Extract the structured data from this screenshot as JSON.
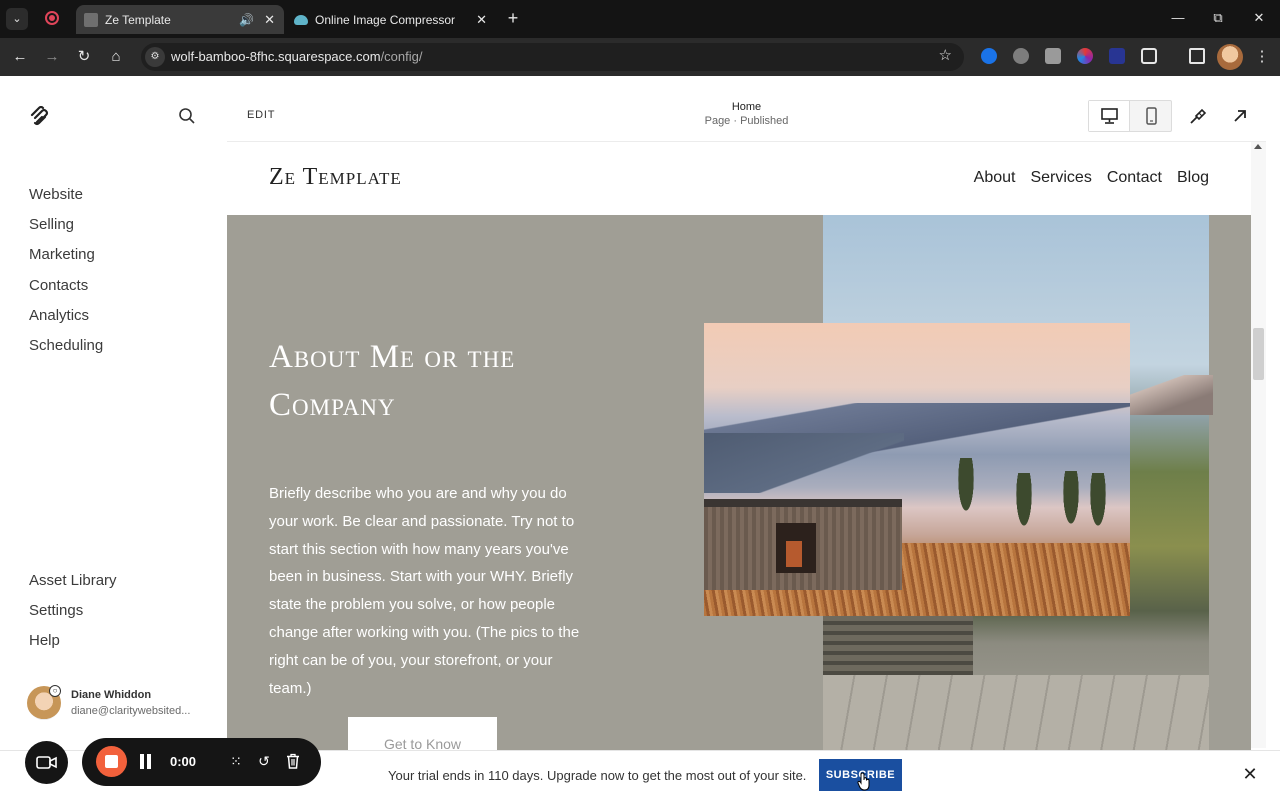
{
  "browser": {
    "tabs": [
      {
        "title": "Ze Template",
        "active": true,
        "audio": true
      },
      {
        "title": "Online Image Compressor",
        "active": false
      }
    ],
    "url_host": "wolf-bamboo-8fhc.squarespace.com",
    "url_path": "/config/",
    "icons": {
      "back": "←",
      "forward": "→",
      "reload": "↻",
      "home": "⌂",
      "star": "☆",
      "newtab": "+",
      "minimize": "—",
      "restore": "⧉",
      "close": "✕",
      "tab_close": "✕",
      "audio": "🔊",
      "tab_search": "⌄"
    }
  },
  "sidebar": {
    "nav": [
      "Website",
      "Selling",
      "Marketing",
      "Contacts",
      "Analytics",
      "Scheduling"
    ],
    "bottom": [
      "Asset Library",
      "Settings",
      "Help"
    ],
    "user": {
      "name": "Diane Whiddon",
      "email": "diane@claritywebsited..."
    }
  },
  "editor": {
    "edit_label": "EDIT",
    "page_title": "Home",
    "page_status": "Page · Published"
  },
  "site": {
    "title": "Ze Template",
    "nav": [
      "About",
      "Services",
      "Contact",
      "Blog"
    ],
    "heading": "About Me or the Company",
    "body": "Briefly describe who you are and why you do your work. Be clear and passionate. Try not to start this section with how many years you've been in business. Start with your WHY. Briefly state the problem you solve, or how people change after working with you. (The pics to the right can be of you, your storefront, or your team.)",
    "cta": "Get to Know"
  },
  "banner": {
    "message": "Your trial ends in 110 days. Upgrade now to get the most out of your site.",
    "button": "SUBSCRIBE",
    "close": "✕"
  },
  "recorder": {
    "time": "0:00",
    "icons": {
      "grid": "⁙",
      "restart": "↺",
      "delete": "␡"
    }
  },
  "colors": {
    "hero_bg": "#a09e95",
    "subscribe": "#1a4fa0",
    "record": "#f2613c"
  }
}
